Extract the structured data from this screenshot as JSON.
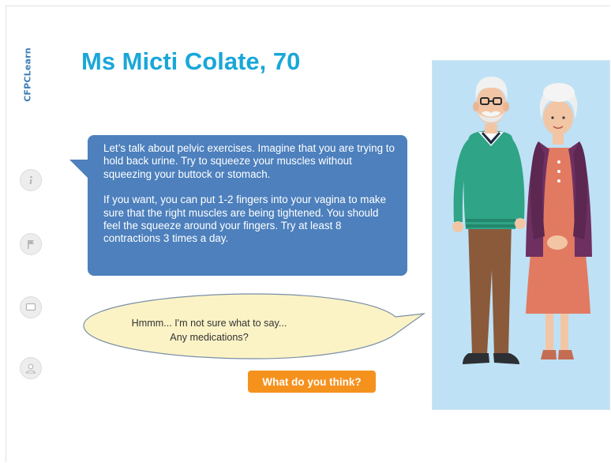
{
  "brand": {
    "name": "CFPCLearn"
  },
  "title": "Ms Micti Colate, 70",
  "sidebar": {
    "icons": [
      "info-icon",
      "flag-icon",
      "chat-icon",
      "user-icon"
    ]
  },
  "doctor_message": {
    "paragraph1": "Let’s talk about pelvic exercises. Imagine that you are trying to hold back urine. Try to squeeze your muscles without squeezing your buttock or stomach.",
    "paragraph2": "If you want, you can put 1-2 fingers into your vagina to make sure that the right muscles are being tightened.  You should feel the squeeze around your fingers. Try at least 8 contractions 3 times a day."
  },
  "patient_reply": {
    "line1": "Hmmm... I'm not sure what to say...",
    "line2": "Any medications?"
  },
  "cta": {
    "label": "What do you think?"
  },
  "colors": {
    "title": "#1aa7d8",
    "doctor_bubble": "#4d80bd",
    "patient_bubble": "#fbf3c6",
    "cta": "#f5921e",
    "illustration_bg": "#bee1f5"
  }
}
